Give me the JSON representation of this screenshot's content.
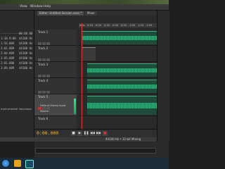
{
  "menubar": {
    "items": [
      "View",
      "Window",
      "Help"
    ]
  },
  "files": [
    {
      "name": "-------------",
      "dur": "00:00.00"
    },
    {
      "name": "1:38.9:00",
      "dur": "44100 Hz"
    },
    {
      "name": "1:56.009",
      "dur": "44100 Hz"
    },
    {
      "name": "2:01.009",
      "dur": "44100 Hz"
    },
    {
      "name": "2:04.009",
      "dur": "44100 Hz"
    },
    {
      "name": "2:05.009",
      "dur": "44100 Hz"
    },
    {
      "name": "2:01.000",
      "dur": "44100 Hz"
    },
    {
      "name": "3:09.009",
      "dur": "44100 Hz"
    }
  ],
  "left_panel_caption": "Instrumental Voicelane",
  "tabs": [
    "Editor: Untitled Session.sesx *",
    "Mixer"
  ],
  "ruler": [
    "hms",
    "0:10",
    "0:20",
    "0:30",
    "0:40",
    "0:50",
    "1:00",
    "1:10",
    "1:20",
    "1:30"
  ],
  "tracks": [
    {
      "name": "Track 1"
    },
    {
      "name": "Track 2"
    },
    {
      "name": "Track 3"
    },
    {
      "name": "Track 4"
    },
    {
      "name": "Track 5"
    },
    {
      "name": "Track 6"
    }
  ],
  "track5_input": "Default Stereo Input",
  "track5_output": "Master",
  "transport": {
    "time": "0:00.000"
  },
  "status": {
    "text": "44100 Hz • 32-bit Mixing"
  }
}
